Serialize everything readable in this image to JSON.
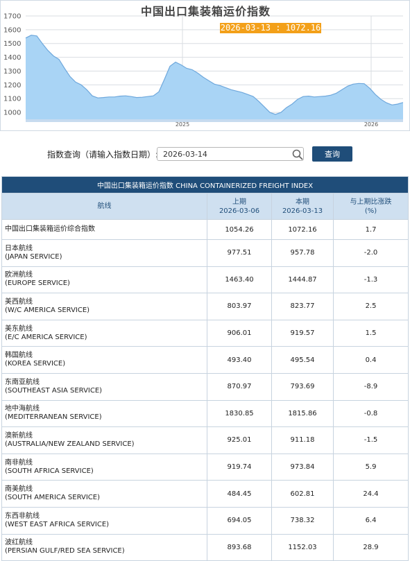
{
  "chart": {
    "title": "中国出口集装箱运价指数",
    "tooltip": "2026-03-13 : 1072.16",
    "colors": {
      "fill": "#a9d4f5",
      "line": "#6fa8dc",
      "grid": "#d9dde2",
      "tooltip": "#f3a019"
    }
  },
  "chart_data": {
    "type": "area",
    "title": "中国出口集装箱运价指数",
    "xlabel": "",
    "ylabel": "",
    "ylim": [
      950,
      1700
    ],
    "yticks": [
      1000,
      1100,
      1200,
      1300,
      1400,
      1500,
      1600,
      1700
    ],
    "xtick_labels": [
      "2025",
      "2026"
    ],
    "grid": true,
    "series": [
      {
        "values": [
          1540,
          1560,
          1555,
          1500,
          1450,
          1410,
          1385,
          1320,
          1260,
          1220,
          1200,
          1165,
          1120,
          1105,
          1108,
          1112,
          1112,
          1118,
          1120,
          1115,
          1108,
          1110,
          1115,
          1120,
          1150,
          1240,
          1335,
          1365,
          1345,
          1320,
          1310,
          1285,
          1255,
          1230,
          1205,
          1195,
          1180,
          1165,
          1155,
          1145,
          1130,
          1115,
          1080,
          1040,
          1000,
          985,
          1000,
          1035,
          1060,
          1095,
          1115,
          1118,
          1112,
          1115,
          1118,
          1125,
          1140,
          1165,
          1190,
          1205,
          1210,
          1208,
          1175,
          1130,
          1095,
          1070,
          1054,
          1060,
          1072
        ]
      }
    ]
  },
  "query": {
    "label": "指数查询（请输入指数日期）:",
    "date_value": "2026-03-14",
    "button_label": "查询"
  },
  "table": {
    "caption": "中国出口集装箱运价指数 CHINA CONTAINERIZED FREIGHT INDEX",
    "headers": {
      "route": "航线",
      "prev_label": "上期",
      "prev_date": "2026-03-06",
      "curr_label": "本期",
      "curr_date": "2026-03-13",
      "change_label": "与上期比涨跌",
      "change_unit": "(%)"
    },
    "rows": [
      {
        "cn": "中国出口集装箱运价综合指数",
        "en": "",
        "prev": "1054.26",
        "curr": "1072.16",
        "change": "1.7"
      },
      {
        "cn": "日本航线",
        "en": "(JAPAN SERVICE)",
        "prev": "977.51",
        "curr": "957.78",
        "change": "-2.0"
      },
      {
        "cn": "欧洲航线",
        "en": "(EUROPE SERVICE)",
        "prev": "1463.40",
        "curr": "1444.87",
        "change": "-1.3"
      },
      {
        "cn": "美西航线",
        "en": "(W/C AMERICA SERVICE)",
        "prev": "803.97",
        "curr": "823.77",
        "change": "2.5"
      },
      {
        "cn": "美东航线",
        "en": "(E/C AMERICA SERVICE)",
        "prev": "906.01",
        "curr": "919.57",
        "change": "1.5"
      },
      {
        "cn": "韩国航线",
        "en": "(KOREA SERVICE)",
        "prev": "493.40",
        "curr": "495.54",
        "change": "0.4"
      },
      {
        "cn": "东南亚航线",
        "en": "(SOUTHEAST ASIA SERVICE)",
        "prev": "870.97",
        "curr": "793.69",
        "change": "-8.9"
      },
      {
        "cn": "地中海航线",
        "en": "(MEDITERRANEAN SERVICE)",
        "prev": "1830.85",
        "curr": "1815.86",
        "change": "-0.8"
      },
      {
        "cn": "澳新航线",
        "en": "(AUSTRALIA/NEW ZEALAND SERVICE)",
        "prev": "925.01",
        "curr": "911.18",
        "change": "-1.5"
      },
      {
        "cn": "南非航线",
        "en": "(SOUTH AFRICA SERVICE)",
        "prev": "919.74",
        "curr": "973.84",
        "change": "5.9"
      },
      {
        "cn": "南美航线",
        "en": "(SOUTH AMERICA SERVICE)",
        "prev": "484.45",
        "curr": "602.81",
        "change": "24.4"
      },
      {
        "cn": "东西非航线",
        "en": "(WEST EAST AFRICA SERVICE)",
        "prev": "694.05",
        "curr": "738.32",
        "change": "6.4"
      },
      {
        "cn": "波红航线",
        "en": "(PERSIAN GULF/RED SEA SERVICE)",
        "prev": "893.68",
        "curr": "1152.03",
        "change": "28.9"
      }
    ]
  }
}
